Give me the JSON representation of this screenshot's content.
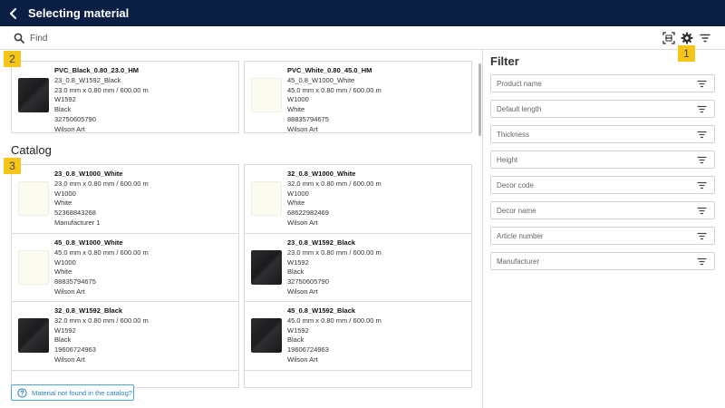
{
  "header": {
    "title": "Selecting material"
  },
  "search": {
    "placeholder": "Find"
  },
  "recent": [
    {
      "name": "PVC_Black_0.80_23.0_HM",
      "code": "23_0.8_W1592_Black",
      "dims": "23.0 mm x 0.80 mm / 600.00 m",
      "decor": "W1592",
      "color": "Black",
      "article": "32750605790",
      "manufacturer": "Wilson Art",
      "swatch": "black"
    },
    {
      "name": "PVC_White_0.80_45.0_HM",
      "code": "45_0.8_W1000_White",
      "dims": "45.0 mm x 0.80 mm / 600.00 m",
      "decor": "W1000",
      "color": "White",
      "article": "88835794675",
      "manufacturer": "Wilson Art",
      "swatch": "white"
    }
  ],
  "catalog": {
    "title": "Catalog",
    "items": [
      {
        "name": "23_0.8_W1000_White",
        "dims": "23.0 mm x 0.80 mm / 600.00 m",
        "decor": "W1000",
        "color": "White",
        "article": "52368843268",
        "manufacturer": "Manufacturer 1",
        "swatch": "white"
      },
      {
        "name": "32_0.8_W1000_White",
        "dims": "32.0 mm x 0.80 mm / 600.00 m",
        "decor": "W1000",
        "color": "White",
        "article": "68622982469",
        "manufacturer": "Wilson Art",
        "swatch": "white"
      },
      {
        "name": "45_0.8_W1000_White",
        "dims": "45.0 mm x 0.80 mm / 600.00 m",
        "decor": "W1000",
        "color": "White",
        "article": "88835794675",
        "manufacturer": "Wilson Art",
        "swatch": "white"
      },
      {
        "name": "23_0.8_W1592_Black",
        "dims": "23.0 mm x 0.80 mm / 600.00 m",
        "decor": "W1592",
        "color": "Black",
        "article": "32750605790",
        "manufacturer": "Wilson Art",
        "swatch": "black"
      },
      {
        "name": "32_0.8_W1592_Black",
        "dims": "32.0 mm x 0.80 mm / 600.00 m",
        "decor": "W1592",
        "color": "Black",
        "article": "19606724963",
        "manufacturer": "Wilson Art",
        "swatch": "black"
      },
      {
        "name": "45_0.8_W1592_Black",
        "dims": "45.0 mm x 0.80 mm / 600.00 m",
        "decor": "W1592",
        "color": "Black",
        "article": "19606724963",
        "manufacturer": "Wilson Art",
        "swatch": "black"
      }
    ]
  },
  "not_found_label": "Material not found in the catalog?",
  "filter": {
    "title": "Filter",
    "fields": [
      "Product name",
      "Default length",
      "Thickness",
      "Height",
      "Decor code",
      "Decor name",
      "Article number",
      "Manufacturer"
    ]
  },
  "badges": [
    "1",
    "2",
    "3"
  ],
  "icons": {
    "back": "chevron-left-icon",
    "search": "search-icon",
    "scan": "barcode-scan-icon",
    "settings": "gear-icon",
    "filter": "filter-lines-icon",
    "help": "question-circle-icon"
  },
  "colors": {
    "header_bg": "#0b1f45",
    "badge": "#f5c518",
    "link_blue": "#2a7fb8"
  }
}
